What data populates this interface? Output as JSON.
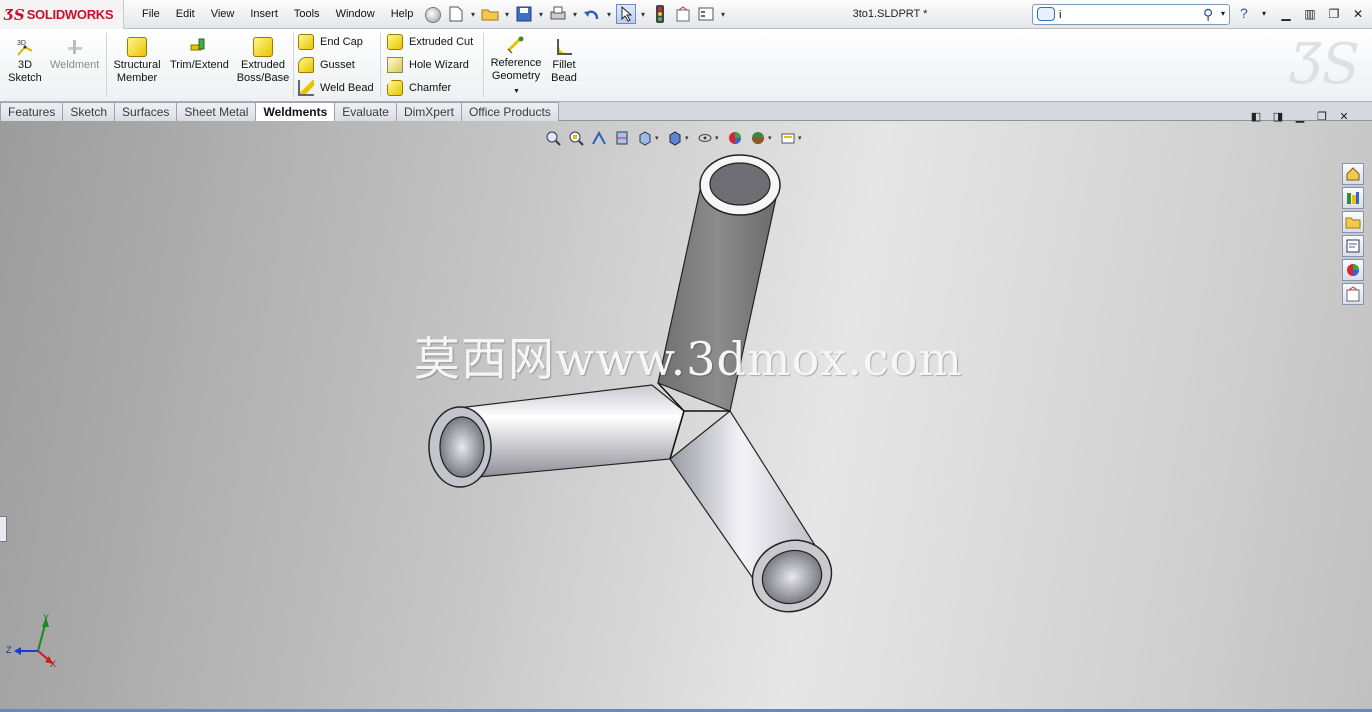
{
  "app": {
    "logo_text": "SOLIDWORKS",
    "document_title": "3to1.SLDPRT *"
  },
  "menu": [
    "File",
    "Edit",
    "View",
    "Insert",
    "Tools",
    "Window",
    "Help"
  ],
  "search": {
    "value": "i"
  },
  "ribbon": {
    "sketch3d": "3D Sketch",
    "weldment": "Weldment",
    "structural_member": "Structural Member",
    "trim_extend": "Trim/Extend",
    "extruded_boss": "Extruded Boss/Base",
    "end_cap": "End Cap",
    "gusset": "Gusset",
    "weld_bead": "Weld Bead",
    "extruded_cut": "Extruded Cut",
    "hole_wizard": "Hole Wizard",
    "chamfer": "Chamfer",
    "reference_geometry": "Reference Geometry",
    "fillet_bead": "Fillet Bead"
  },
  "tabs": [
    "Features",
    "Sketch",
    "Surfaces",
    "Sheet Metal",
    "Weldments",
    "Evaluate",
    "DimXpert",
    "Office Products"
  ],
  "active_tab": "Weldments",
  "watermark": "莫西网www.3dmox.com",
  "triad": {
    "x": "X",
    "y": "Y",
    "z": "Z"
  },
  "colors": {
    "brand": "#c8102e",
    "accent": "#2f6fc9"
  }
}
